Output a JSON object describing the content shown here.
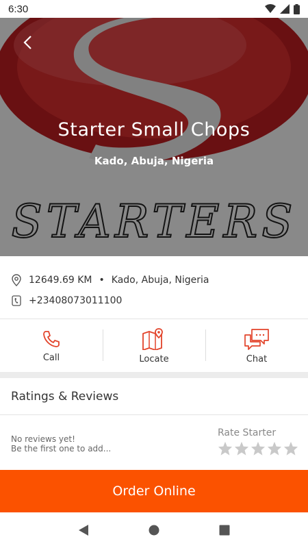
{
  "status_bar": {
    "time": "6:30"
  },
  "hero": {
    "title": "Starter Small Chops",
    "subtitle": "Kado, Abuja, Nigeria",
    "logo_text": "STARTERS",
    "logo_letter": "S"
  },
  "info": {
    "distance": "12649.69 KM",
    "separator": "•",
    "location": "Kado, Abuja, Nigeria",
    "phone": "+23408073011100"
  },
  "actions": [
    {
      "label": "Call",
      "icon": "phone-icon"
    },
    {
      "label": "Locate",
      "icon": "map-icon"
    },
    {
      "label": "Chat",
      "icon": "chat-icon"
    }
  ],
  "reviews": {
    "heading": "Ratings & Reviews",
    "empty_line1": "No reviews yet!",
    "empty_line2": "Be the first one to add...",
    "rate_label": "Rate Starter",
    "rating": 0,
    "max_rating": 5
  },
  "order_button": {
    "label": "Order Online"
  },
  "colors": {
    "accent": "#fb5200",
    "icon_red": "#e2432a",
    "logo_red": "#b51c20"
  }
}
